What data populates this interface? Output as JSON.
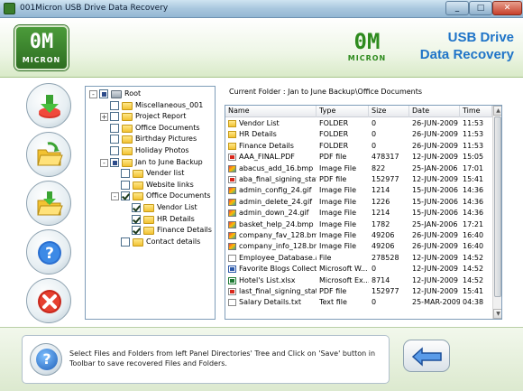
{
  "window": {
    "title": "001Micron USB Drive Data Recovery"
  },
  "header": {
    "logo_mark": "0M",
    "logo_word": "MICRON",
    "product_title": "USB Drive\nData Recovery"
  },
  "toolbar": {
    "buttons": [
      {
        "icon": "download-icon"
      },
      {
        "icon": "open-folder-icon"
      },
      {
        "icon": "save-folder-icon"
      },
      {
        "icon": "help-icon"
      },
      {
        "icon": "exit-icon"
      }
    ]
  },
  "tree": {
    "items": [
      {
        "label": "Root",
        "level": 0,
        "expander": "-",
        "check": "part",
        "type": "drive"
      },
      {
        "label": "Miscellaneous_001",
        "level": 1,
        "expander": "",
        "check": "none"
      },
      {
        "label": "Project Report",
        "level": 1,
        "expander": "+",
        "check": "none"
      },
      {
        "label": "Office Documents",
        "level": 1,
        "expander": "",
        "check": "none"
      },
      {
        "label": "Birthday Pictures",
        "level": 1,
        "expander": "",
        "check": "none"
      },
      {
        "label": "Holiday Photos",
        "level": 1,
        "expander": "",
        "check": "none"
      },
      {
        "label": "Jan to June Backup",
        "level": 1,
        "expander": "-",
        "check": "part"
      },
      {
        "label": "Vender list",
        "level": 2,
        "expander": "",
        "check": "none"
      },
      {
        "label": "Website links",
        "level": 2,
        "expander": "",
        "check": "none"
      },
      {
        "label": "Office Documents",
        "level": 2,
        "expander": "-",
        "check": "full"
      },
      {
        "label": "Vendor List",
        "level": 3,
        "expander": "",
        "check": "full"
      },
      {
        "label": "HR Details",
        "level": 3,
        "expander": "",
        "check": "full"
      },
      {
        "label": "Finance Details",
        "level": 3,
        "expander": "",
        "check": "full"
      },
      {
        "label": "Contact details",
        "level": 2,
        "expander": "",
        "check": "none"
      }
    ]
  },
  "current_folder": "Current Folder : Jan to June Backup\\Office Documents",
  "file_list": {
    "columns": [
      "Name",
      "Type",
      "Size",
      "Date",
      "Time"
    ],
    "rows": [
      {
        "icon": "folder",
        "name": "Vendor List",
        "type": "FOLDER",
        "size": "0",
        "date": "26-JUN-2009",
        "time": "11:53"
      },
      {
        "icon": "folder",
        "name": "HR Details",
        "type": "FOLDER",
        "size": "0",
        "date": "26-JUN-2009",
        "time": "11:53"
      },
      {
        "icon": "folder",
        "name": "Finance Details",
        "type": "FOLDER",
        "size": "0",
        "date": "26-JUN-2009",
        "time": "11:53"
      },
      {
        "icon": "pdf",
        "name": "AAA_FINAL.PDF",
        "type": "PDF file",
        "size": "478317",
        "date": "12-JUN-2009",
        "time": "15:05"
      },
      {
        "icon": "img",
        "name": "abacus_add_16.bmp",
        "type": "Image File",
        "size": "822",
        "date": "25-JAN-2006",
        "time": "17:01"
      },
      {
        "icon": "pdf",
        "name": "aba_final_signing_stat...",
        "type": "PDF file",
        "size": "152977",
        "date": "12-JUN-2009",
        "time": "15:41"
      },
      {
        "icon": "img",
        "name": "admin_config_24.gif",
        "type": "Image File",
        "size": "1214",
        "date": "15-JUN-2006",
        "time": "14:36"
      },
      {
        "icon": "img",
        "name": "admin_delete_24.gif",
        "type": "Image File",
        "size": "1226",
        "date": "15-JUN-2006",
        "time": "14:36"
      },
      {
        "icon": "img",
        "name": "admin_down_24.gif",
        "type": "Image File",
        "size": "1214",
        "date": "15-JUN-2006",
        "time": "14:36"
      },
      {
        "icon": "img",
        "name": "basket_help_24.bmp",
        "type": "Image File",
        "size": "1782",
        "date": "25-JAN-2006",
        "time": "17:21"
      },
      {
        "icon": "img",
        "name": "company_fav_128.bmp",
        "type": "Image File",
        "size": "49206",
        "date": "26-JUN-2009",
        "time": "16:40"
      },
      {
        "icon": "img",
        "name": "company_info_128.bmp",
        "type": "Image File",
        "size": "49206",
        "date": "26-JUN-2009",
        "time": "16:40"
      },
      {
        "icon": "file",
        "name": "Employee_Database.a...",
        "type": "File",
        "size": "278528",
        "date": "12-JUN-2009",
        "time": "14:52"
      },
      {
        "icon": "word",
        "name": "Favorite Blogs Collecti...",
        "type": "Microsoft W...",
        "size": "0",
        "date": "12-JUN-2009",
        "time": "14:52"
      },
      {
        "icon": "xls",
        "name": "Hotel's List.xlsx",
        "type": "Microsoft Ex...",
        "size": "8714",
        "date": "12-JUN-2009",
        "time": "14:52"
      },
      {
        "icon": "pdf",
        "name": "last_final_signing_stat...",
        "type": "PDF file",
        "size": "152977",
        "date": "12-JUN-2009",
        "time": "15:41"
      },
      {
        "icon": "file",
        "name": "Salary Details.txt",
        "type": "Text file",
        "size": "0",
        "date": "25-MAR-2009",
        "time": "04:38"
      }
    ]
  },
  "status": {
    "help_glyph": "?",
    "message": "Select Files and Folders from left Panel Directories' Tree and Click on 'Save' button in Toolbar to save recovered Files and Folders."
  },
  "colors": {
    "brand_green": "#2e8b1e",
    "title_blue": "#1f74c8"
  }
}
